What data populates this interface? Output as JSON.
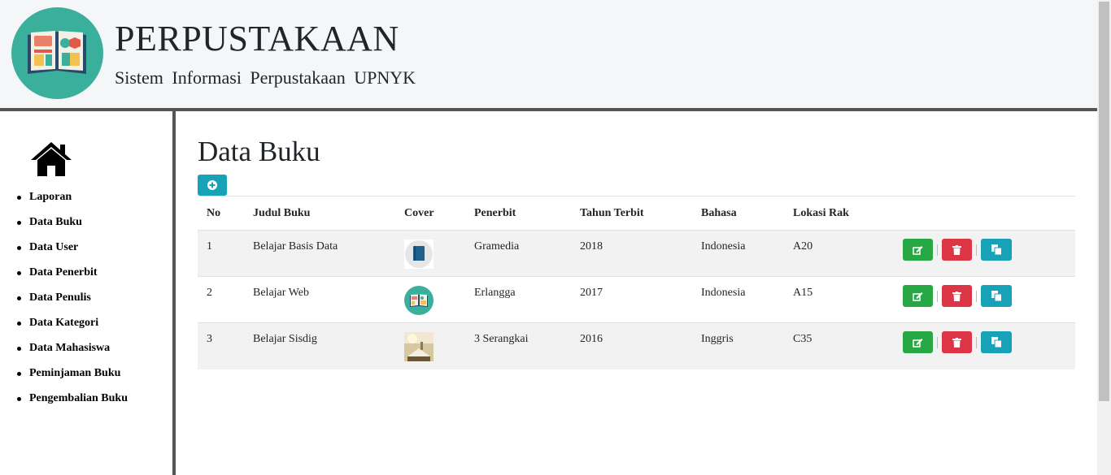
{
  "header": {
    "title": "PERPUSTAKAAN",
    "subtitle": "Sistem Informasi Perpustakaan UPNYK",
    "logo_icon": "open-book-logo"
  },
  "sidebar": {
    "home_icon": "home-icon",
    "items": [
      {
        "label": "Laporan"
      },
      {
        "label": "Data Buku"
      },
      {
        "label": "Data User"
      },
      {
        "label": "Data Penerbit"
      },
      {
        "label": "Data Penulis"
      },
      {
        "label": "Data Kategori"
      },
      {
        "label": "Data Mahasiswa"
      },
      {
        "label": "Peminjaman Buku"
      },
      {
        "label": "Pengembalian Buku"
      }
    ]
  },
  "main": {
    "title": "Data Buku",
    "add_icon": "plus-circle-icon",
    "columns": [
      "No",
      "Judul Buku",
      "Cover",
      "Penerbit",
      "Tahun Terbit",
      "Bahasa",
      "Lokasi Rak",
      ""
    ],
    "rows": [
      {
        "no": "1",
        "judul": "Belajar Basis Data",
        "cover": "blue-book-cover",
        "penerbit": "Gramedia",
        "tahun": "2018",
        "bahasa": "Indonesia",
        "rak": "A20"
      },
      {
        "no": "2",
        "judul": "Belajar Web",
        "cover": "open-book-cover",
        "penerbit": "Erlangga",
        "tahun": "2017",
        "bahasa": "Indonesia",
        "rak": "A15"
      },
      {
        "no": "3",
        "judul": "Belajar Sisdig",
        "cover": "photo-book-cover",
        "penerbit": "3 Serangkai",
        "tahun": "2016",
        "bahasa": "Inggris",
        "rak": "C35"
      }
    ],
    "action_icons": {
      "edit": "edit-icon",
      "delete": "trash-icon",
      "copy": "copy-icon"
    }
  },
  "colors": {
    "header_bg": "#f5f6f8",
    "logo_bg": "#3aaf9b",
    "divider": "#555555",
    "info": "#17a2b8",
    "success": "#28a745",
    "danger": "#dc3545"
  }
}
